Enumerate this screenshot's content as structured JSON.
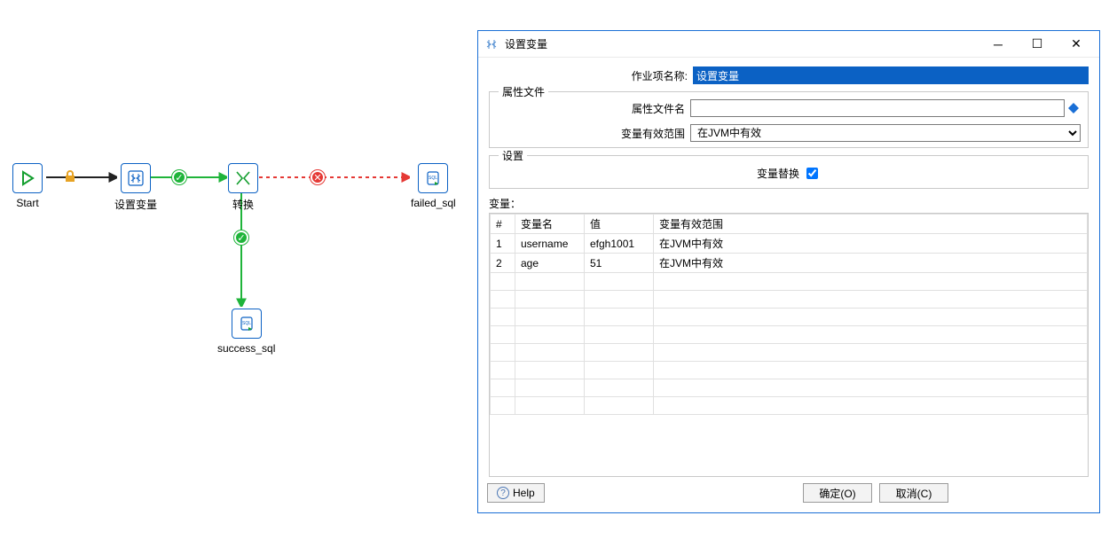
{
  "canvas": {
    "nodes": {
      "start": "Start",
      "setvar": "设置变量",
      "transform": "转换",
      "failed": "failed_sql",
      "success": "success_sql"
    }
  },
  "dialog": {
    "title": "设置变量",
    "jobitem_label": "作业项名称:",
    "jobitem_value": "设置变量",
    "propfile_group": "属性文件",
    "propfile_label": "属性文件名",
    "propfile_value": "",
    "scope_label": "变量有效范围",
    "scope_value": "在JVM中有效",
    "settings_group": "设置",
    "substitute_label": "变量替换",
    "substitute_checked": true,
    "vars_label": "变量：",
    "table": {
      "columns": {
        "idx": "#",
        "name": "变量名",
        "value": "值",
        "scope": "变量有效范围"
      },
      "rows": [
        {
          "idx": "1",
          "name": "username",
          "value": "efgh1001",
          "scope": "在JVM中有效"
        },
        {
          "idx": "2",
          "name": "age",
          "value": "51",
          "scope": "在JVM中有效"
        }
      ]
    },
    "buttons": {
      "help": "Help",
      "ok": "确定(O)",
      "cancel": "取消(C)"
    }
  }
}
